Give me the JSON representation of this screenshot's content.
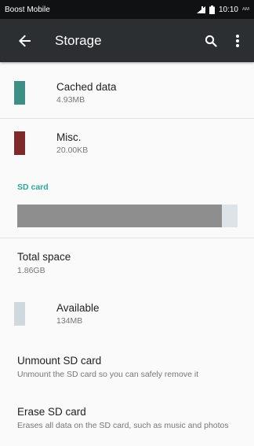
{
  "status_bar": {
    "carrier": "Boost Mobile",
    "time": "10:10",
    "am_pm": "AM",
    "icons": [
      "signal-icon",
      "battery-icon"
    ]
  },
  "app_bar": {
    "title": "Storage",
    "icons": {
      "back": "arrow-back-icon",
      "search": "search-icon",
      "more": "more-vert-icon"
    }
  },
  "items": {
    "cached": {
      "label": "Cached data",
      "size": "4.93MB",
      "color": "#3d8f86"
    },
    "misc": {
      "label": "Misc.",
      "size": "20.00KB",
      "color": "#7e2a2a"
    }
  },
  "sd_card": {
    "header": "SD card",
    "used_fraction": 0.93,
    "used_color": "#8e8e8e",
    "free_color": "#dde3e6",
    "total": {
      "label": "Total space",
      "value": "1.86GB"
    },
    "available": {
      "label": "Available",
      "value": "134MB",
      "color": "#cfd8dc"
    },
    "unmount": {
      "title": "Unmount SD card",
      "summary": "Unmount the SD card so you can safely remove it"
    },
    "erase": {
      "title": "Erase SD card",
      "summary": "Erases all data on the SD card, such as music and photos"
    }
  },
  "colors": {
    "accent": "#2aa89a",
    "app_bar": "#2b2f31",
    "status_bar": "#0f1112"
  }
}
